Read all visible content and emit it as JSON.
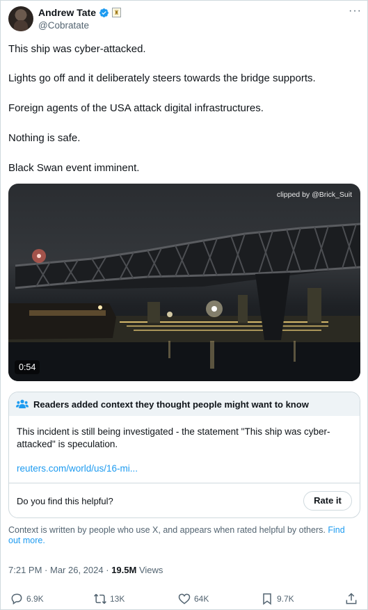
{
  "author": {
    "name": "Andrew Tate",
    "handle": "@Cobratate",
    "verified_color": "#1d9bf0",
    "affiliation_badge": "♜"
  },
  "menu_icon": "more-icon",
  "tweet": {
    "lines": [
      "This ship was cyber-attacked.",
      "Lights go off and it deliberately steers towards the bridge supports.",
      "Foreign agents of the USA attack digital infrastructures.",
      "Nothing is safe.",
      "Black Swan event imminent."
    ]
  },
  "media": {
    "watermark": "clipped by @Brick_Suit",
    "duration": "0:54"
  },
  "community_note": {
    "header": "Readers added context they thought people might want to know",
    "body": "This incident is still being investigated - the statement \"This ship was cyber-attacked\" is speculation.",
    "link": "reuters.com/world/us/16-mi...",
    "helpful_prompt": "Do you find this helpful?",
    "rate_button": "Rate it"
  },
  "context_note": {
    "text": "Context is written by people who use X, and appears when rated helpful by others.",
    "link": "Find out more."
  },
  "meta": {
    "time": "7:21 PM",
    "date": "Mar 26, 2024",
    "views_count": "19.5M",
    "views_label": "Views"
  },
  "actions": {
    "replies": "6.9K",
    "reposts": "13K",
    "likes": "64K",
    "bookmarks": "9.7K"
  },
  "colors": {
    "accent": "#1d9bf0",
    "secondary_text": "#536471",
    "border": "#cfd9de"
  }
}
